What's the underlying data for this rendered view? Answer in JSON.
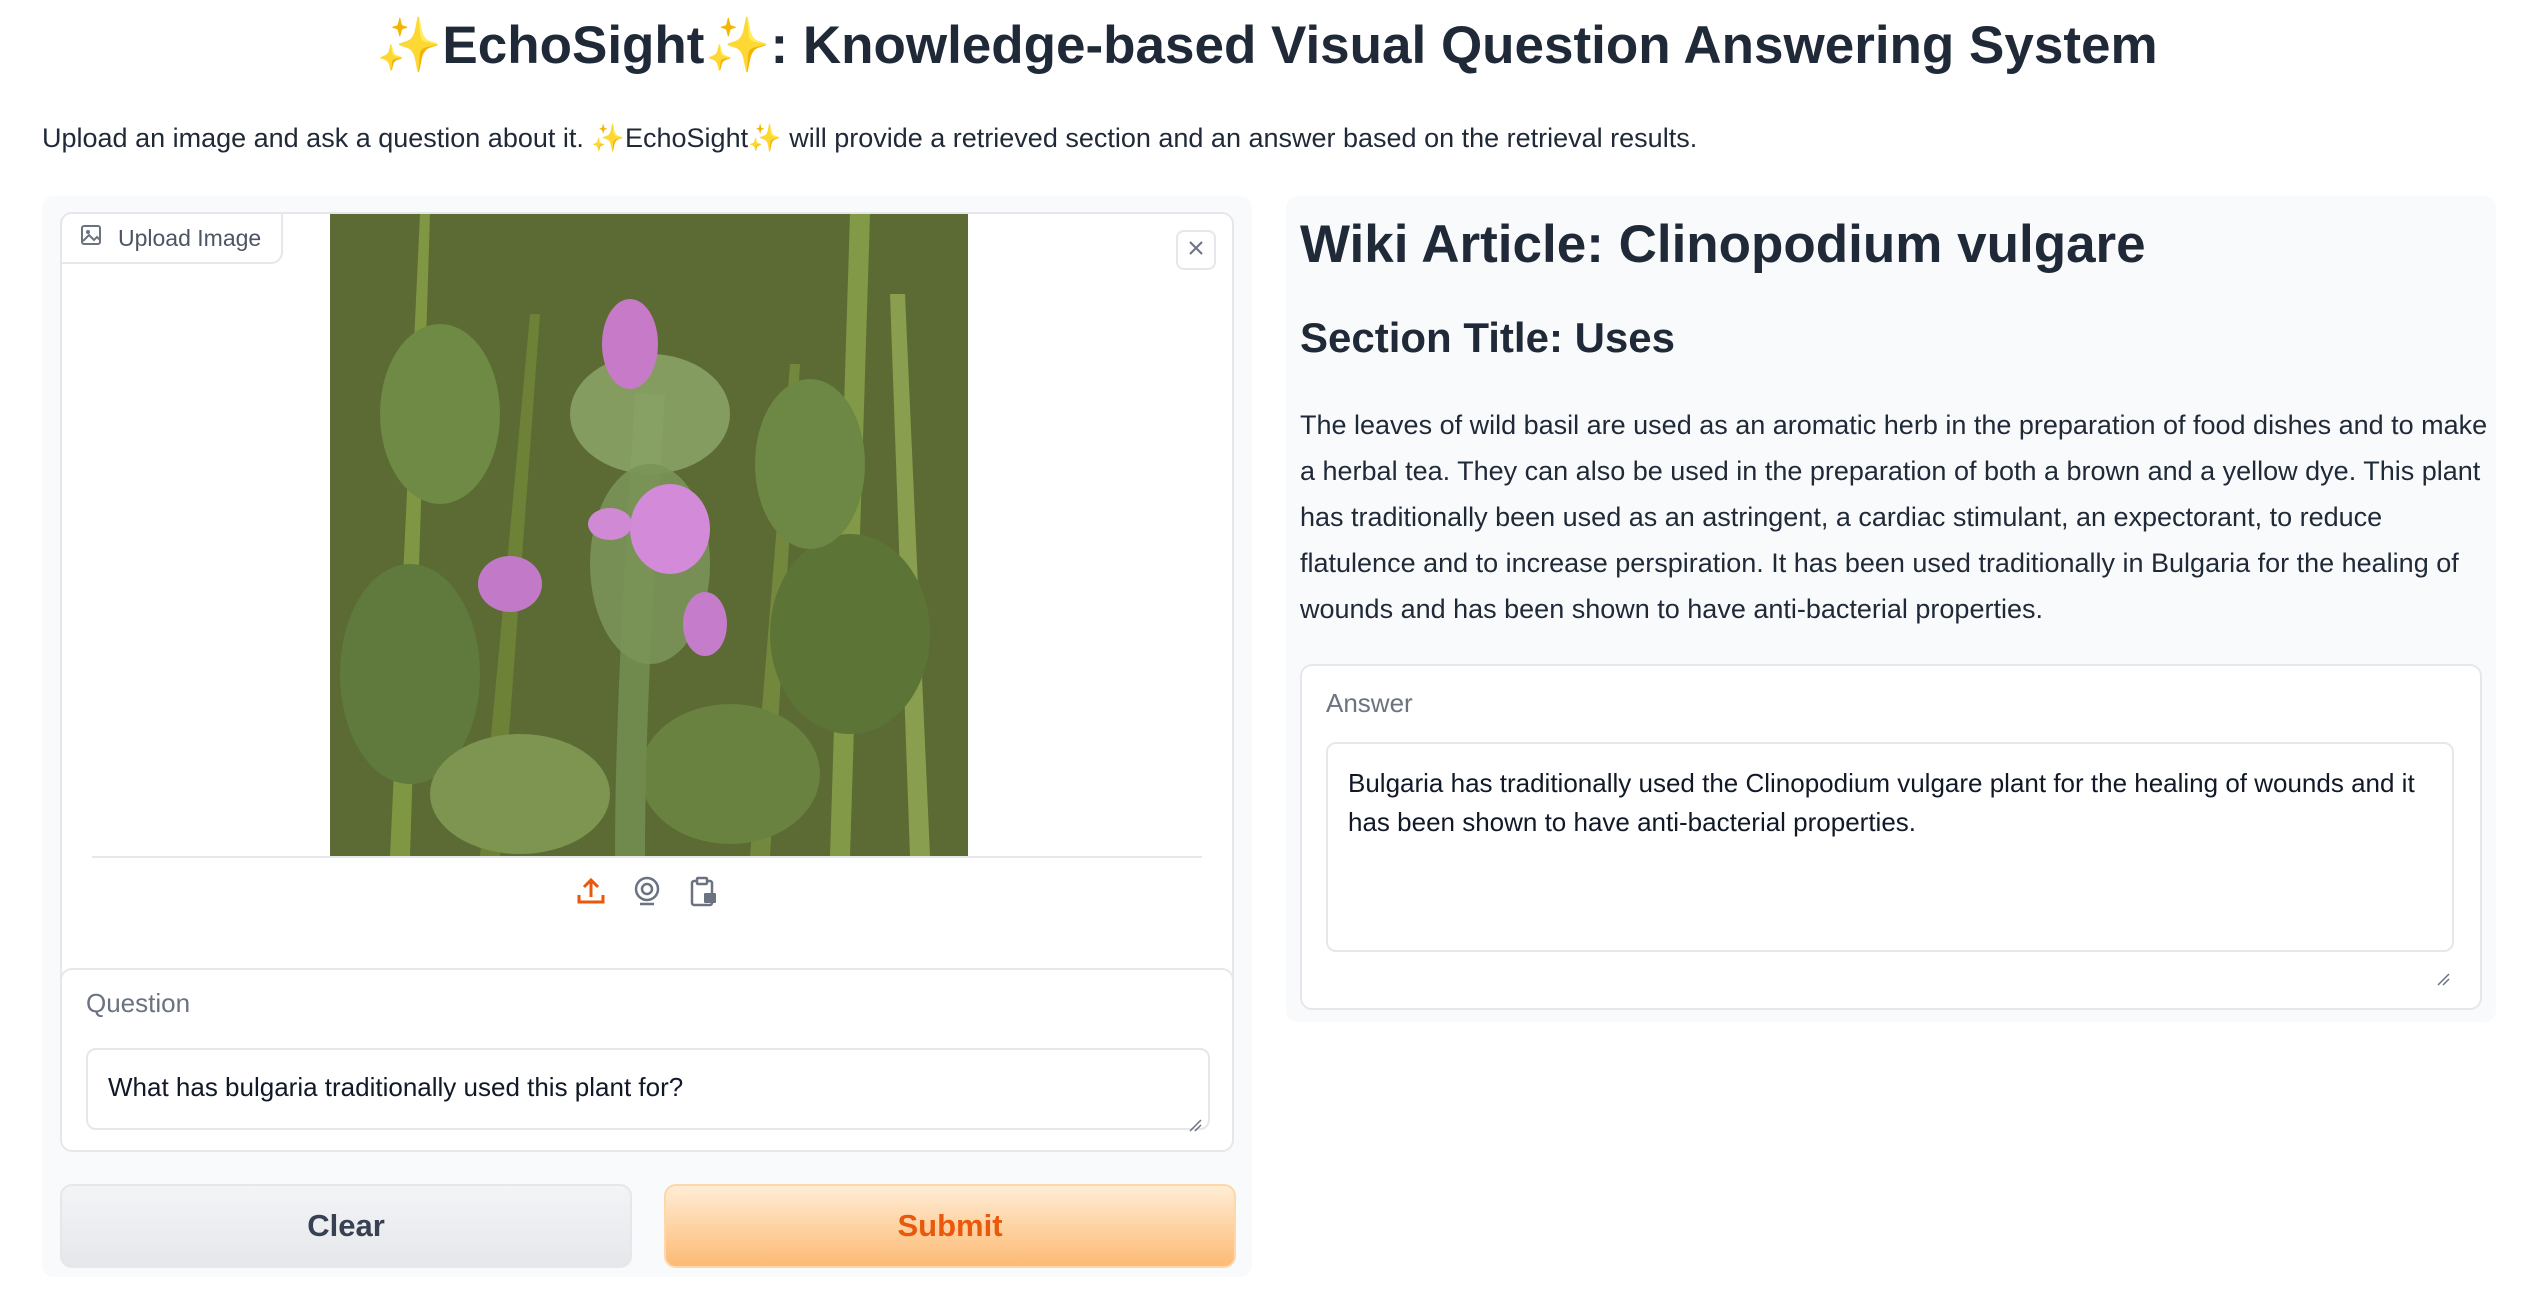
{
  "header": {
    "sparkle": "✨",
    "app_name": "EchoSight",
    "title_suffix": ": Knowledge-based Visual Question Answering System"
  },
  "description": {
    "before": "Upload an image and ask a question about it. ",
    "app_name": "EchoSight",
    "after": " will provide a retrieved section and an answer based on the retrieval results."
  },
  "image_input": {
    "label": "Upload Image",
    "image_alt": "Photo of a plant with pink flowers",
    "source_icons": [
      "upload-icon",
      "webcam-icon",
      "clipboard-icon"
    ]
  },
  "question": {
    "label": "Question",
    "value": "What has bulgaria traditionally used this plant for?"
  },
  "buttons": {
    "clear": "Clear",
    "submit": "Submit"
  },
  "result": {
    "wiki_article": "Wiki Article: Clinopodium vulgare",
    "section_title": "Section Title: Uses",
    "section_text": "The leaves of wild basil are used as an aromatic herb in the preparation of food dishes and to make a herbal tea. They can also be used in the preparation of both a brown and a yellow dye. This plant has traditionally been used as an astringent, a cardiac stimulant, an expectorant, to reduce flatulence and to increase perspiration. It has been used traditionally in Bulgaria for the healing of wounds and has been shown to have anti-bacterial properties.",
    "answer_label": "Answer",
    "answer": "Bulgaria has traditionally used the Clinopodium vulgare plant for the healing of wounds and it has been shown to have anti-bacterial properties."
  },
  "colors": {
    "accent": "#ea580c",
    "submit_bg": "#fdba74",
    "panel_bg": "#f9fafb"
  }
}
